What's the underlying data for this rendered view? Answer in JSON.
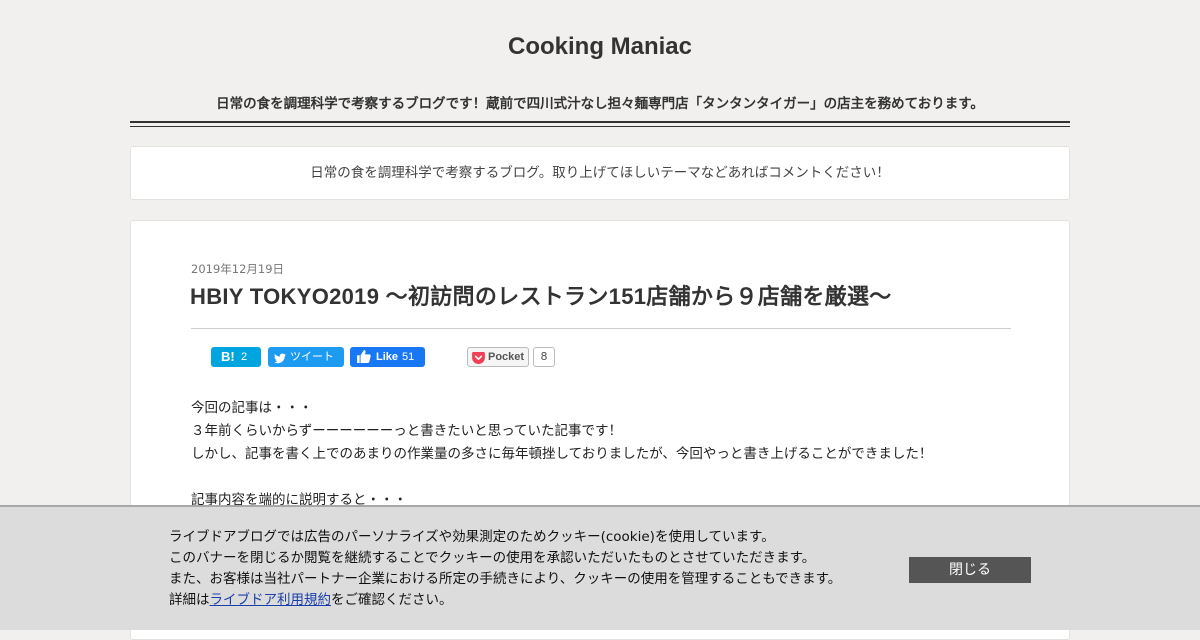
{
  "header": {
    "site_title": "Cooking Maniac",
    "description": "日常の食を調理科学で考察するブログです！蔵前で四川式汁なし担々麺専門店「タンタンタイガー」の店主を務めております。"
  },
  "notice": {
    "text": "日常の食を調理科学で考察するブログ。取り上げてほしいテーマなどあればコメントください！"
  },
  "article": {
    "date": "2019年12月19日",
    "title": "HBIY TOKYO2019 〜初訪問のレストラン151店舗から９店舗を厳選〜",
    "body": [
      "今回の記事は・・・",
      "３年前くらいからずーーーーーーっと書きたいと思っていた記事です！",
      "しかし、記事を書く上でのあまりの作業量の多さに毎年頓挫しておりましたが、今回やっと書き上げることができました！",
      "",
      "記事内容を端的に説明すると・・・"
    ]
  },
  "share": {
    "hatena_label": "B!",
    "hatena_count": "2",
    "tweet_label": "ツイート",
    "like_label": "Like",
    "like_count": "51",
    "pocket_label": "Pocket",
    "pocket_count": "8"
  },
  "cookie_banner": {
    "line1": "ライブドアブログでは広告のパーソナライズや効果測定のためクッキー(cookie)を使用しています。",
    "line2": "このバナーを閉じるか閲覧を継続することでクッキーの使用を承認いただいたものとさせていただきます。",
    "line3": "また、お客様は当社パートナー企業における所定の手続きにより、クッキーの使用を管理することもできます。",
    "line4_prefix": "詳細は",
    "link_text": "ライブドア利用規約",
    "line4_suffix": "をご確認ください。",
    "close_label": "閉じる"
  },
  "colors": {
    "hatena": "#00a4de",
    "twitter": "#1d9bf0",
    "facebook": "#1877f2",
    "pocket": "#ef4056",
    "close_button": "#555555",
    "link": "#1a3fa8"
  },
  "icons": [
    "twitter-bird-icon",
    "thumbs-up-icon",
    "pocket-icon"
  ]
}
